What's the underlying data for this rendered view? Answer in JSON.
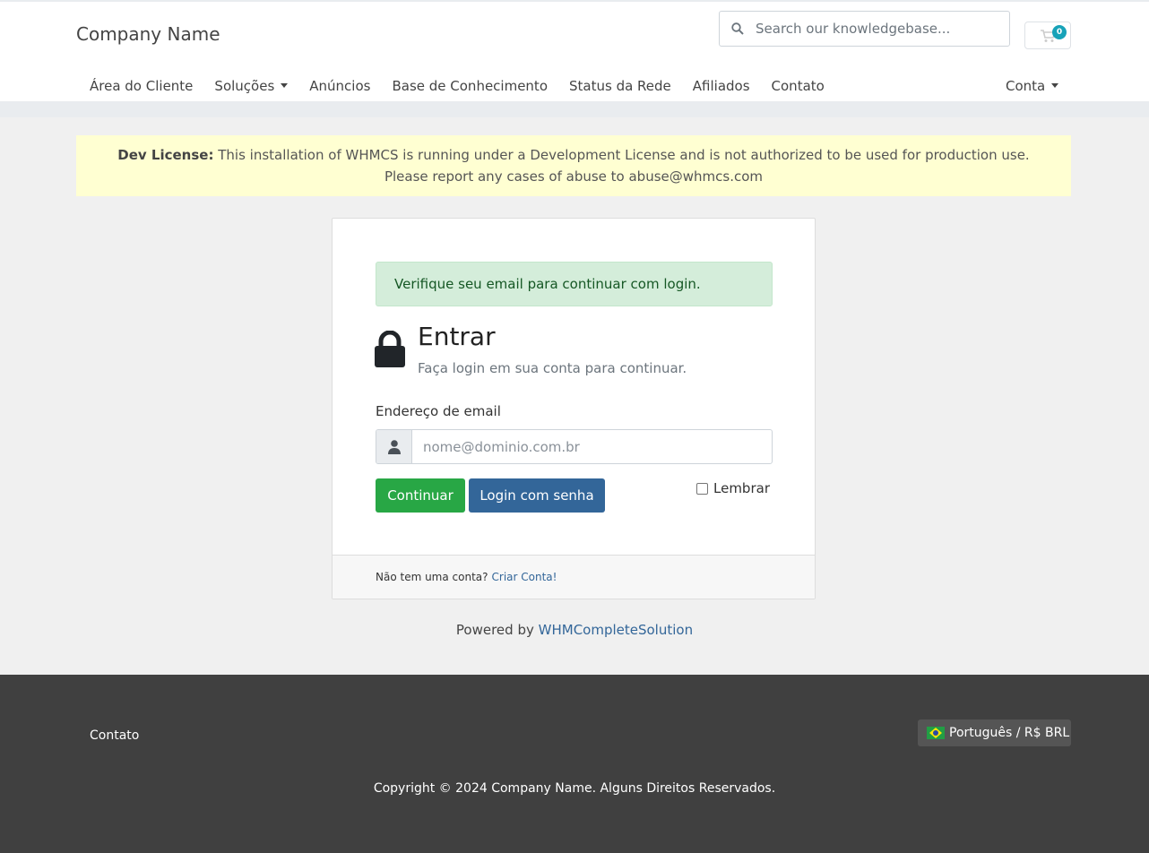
{
  "header": {
    "brand": "Company Name",
    "search_placeholder": "Search our knowledgebase...",
    "cart_count": "0"
  },
  "nav": {
    "items": [
      "Área do Cliente",
      "Soluções",
      "Anúncios",
      "Base de Conhecimento",
      "Status da Rede",
      "Afiliados",
      "Contato"
    ],
    "account": "Conta"
  },
  "dev_license": {
    "label": "Dev License:",
    "line1": "This installation of WHMCS is running under a Development License and is not authorized to be used for production use.",
    "line2": "Please report any cases of abuse to abuse@whmcs.com"
  },
  "login": {
    "alert": "Verifique seu email para continuar com login.",
    "title": "Entrar",
    "subtitle": "Faça login em sua conta para continuar.",
    "email_label": "Endereço de email",
    "email_placeholder": "nome@dominio.com.br",
    "continue_button": "Continuar",
    "password_button": "Login com senha",
    "remember_label": "Lembrar",
    "no_account": "Não tem uma conta?",
    "create_account": "Criar Conta!"
  },
  "powered": {
    "prefix": "Powered by",
    "link": "WHMCompleteSolution"
  },
  "footer": {
    "contact": "Contato",
    "language": "Português / R$ BRL",
    "copyright": "Copyright © 2024 Company Name. Alguns Direitos Reservados."
  },
  "colors": {
    "primary": "#336699",
    "success": "#28a745",
    "footer_bg": "#404040",
    "dev_bg": "#ffffd2"
  }
}
